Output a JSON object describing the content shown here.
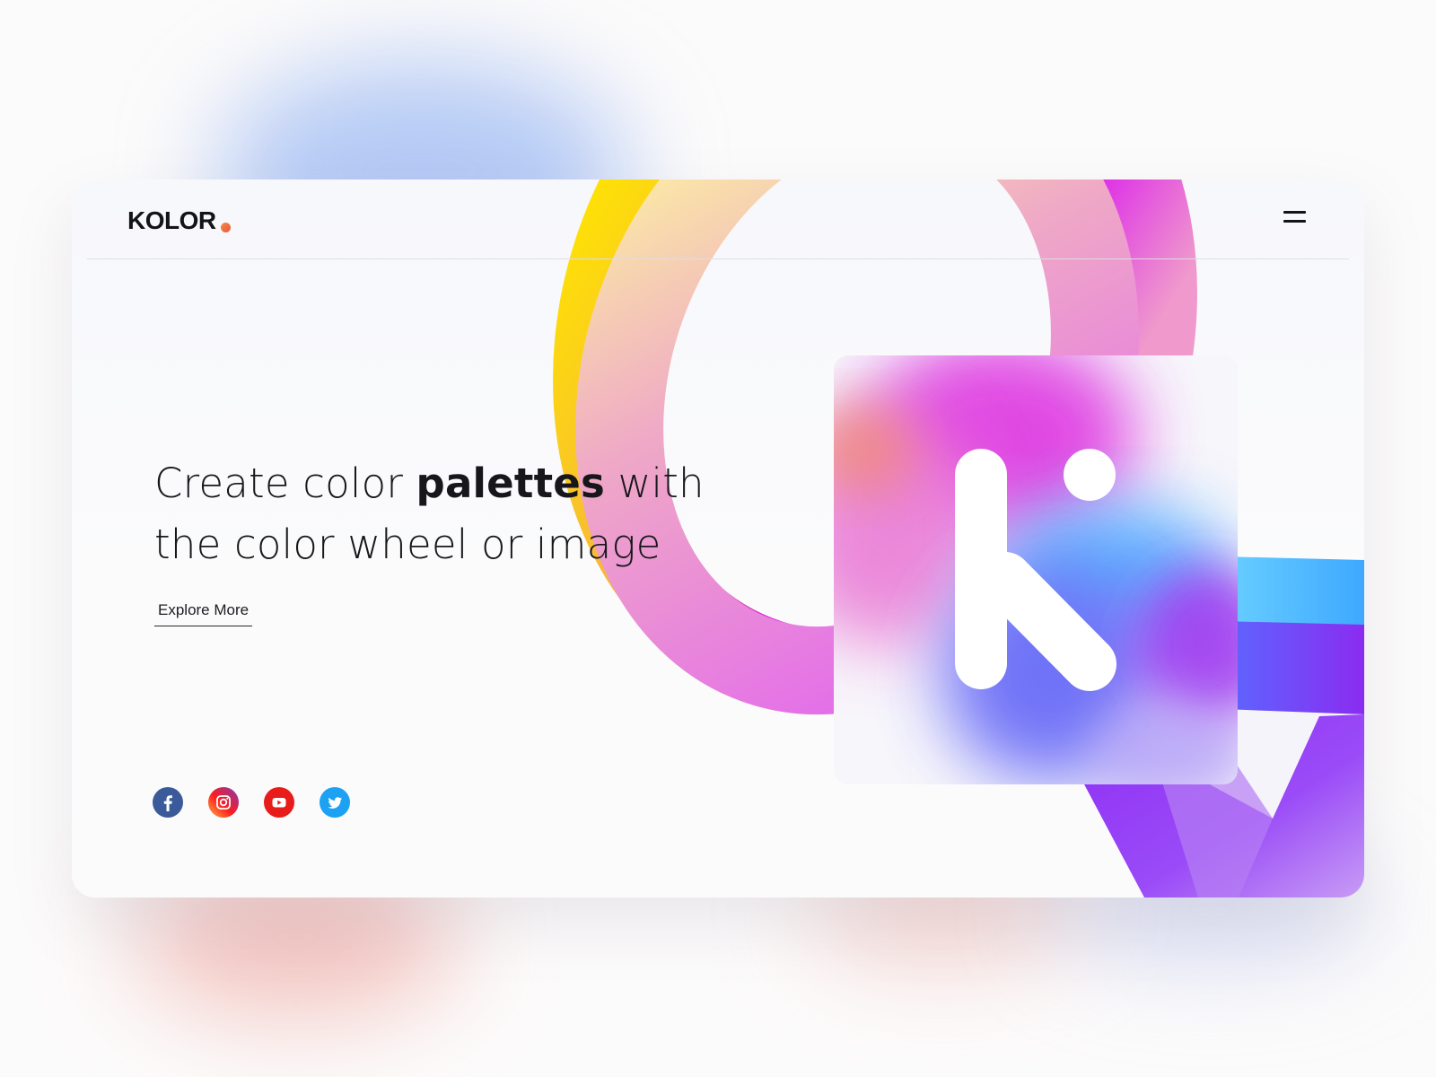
{
  "brand": {
    "name": "KOLOR",
    "dot_color": "#ee6b3e"
  },
  "nav": {
    "menu_icon": "hamburger-menu-icon"
  },
  "hero": {
    "title_before": "Create color ",
    "title_bold": "palettes",
    "title_after": " with the color wheel or image",
    "cta_label": "Explore More"
  },
  "socials": [
    {
      "name": "facebook",
      "icon": "facebook-icon",
      "color": "#3b5a9a"
    },
    {
      "name": "instagram",
      "icon": "instagram-icon",
      "color": "#e1306c"
    },
    {
      "name": "youtube",
      "icon": "youtube-icon",
      "color": "#e91c1c"
    },
    {
      "name": "twitter",
      "icon": "twitter-icon",
      "color": "#1da1f2"
    }
  ],
  "colors": {
    "yellow": "#ffe600",
    "magenta": "#d926e8",
    "pink": "#ee94c8",
    "blue": "#57b6ff",
    "violet": "#8a2be2",
    "text": "#17171b"
  }
}
